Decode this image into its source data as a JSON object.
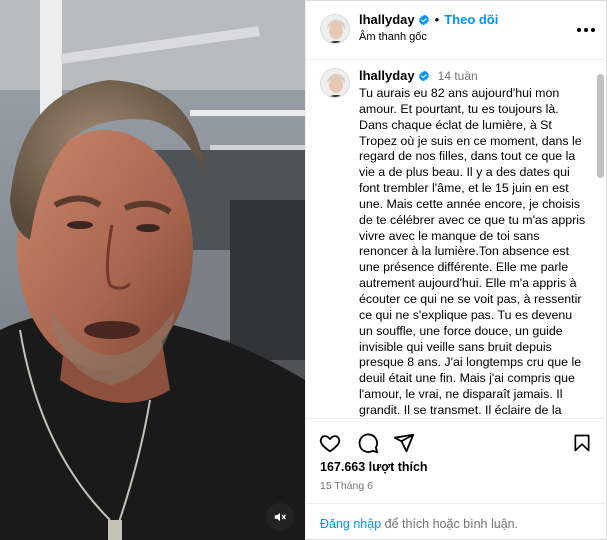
{
  "colors": {
    "accent": "#0095f6",
    "muted": "#737373",
    "border": "#efefef",
    "verified": "#0095f6"
  },
  "media": {
    "description_icon": "photo-of-man",
    "mute_icon": "speaker-muted-icon"
  },
  "header": {
    "username": "lhallyday",
    "separator": "•",
    "follow_label": "Theo dõi",
    "audio_label": "Âm thanh gốc",
    "more_icon": "more-horizontal-icon"
  },
  "caption": {
    "username": "lhallyday",
    "time": "14 tuần",
    "text": "Tu aurais eu 82 ans aujourd'hui mon amour. Et pourtant, tu es toujours là. Dans chaque éclat de lumière, à St Tropez où je suis en ce moment, dans le regard de nos filles, dans tout ce que la vie a de plus beau. Il y a des dates qui font trembler l'âme, et le 15 juin en est une. Mais cette année encore, je choisis de te célébrer avec ce que tu m'as appris vivre avec le manque de toi sans renoncer à la lumière.Ton absence est une présence différente. Elle me parle autrement aujourd'hui. Elle m'a appris à écouter ce qui ne se voit pas, à ressentir ce qui ne s'explique pas. Tu es devenu un souffle, une force douce, un guide invisible qui veille sans bruit depuis presque 8 ans. J'ai longtemps cru que le deuil était une fin. Mais j'ai compris que l'amour, le vrai, ne disparaît jamais. Il grandit. Il se transmet. Il éclaire de la"
  },
  "actions": {
    "like_icon": "heart-icon",
    "comment_icon": "comment-icon",
    "share_icon": "send-icon",
    "save_icon": "bookmark-icon"
  },
  "likes_label": "167.663 lượt thích",
  "date_label": "15 Tháng 6",
  "login": {
    "link": "Đăng nhập",
    "rest": " để thích hoặc bình luận."
  }
}
